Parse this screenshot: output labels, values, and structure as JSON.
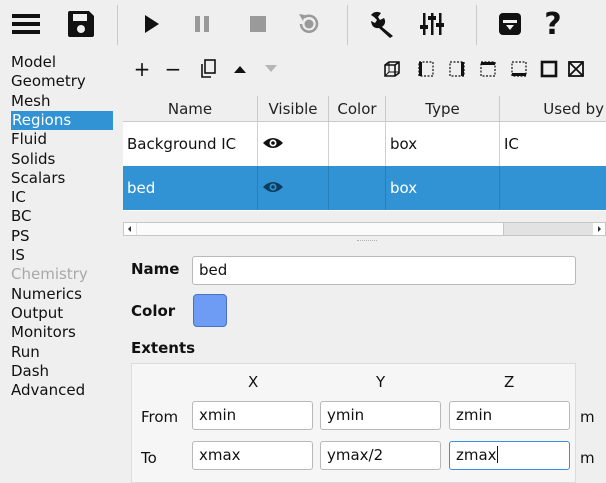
{
  "toolbar": {
    "icons": [
      "menu-icon",
      "save-icon",
      "play-icon",
      "pause-icon",
      "stop-icon",
      "reset-icon",
      "wrench-icon",
      "sliders-icon",
      "archive-icon",
      "help-icon"
    ],
    "help_label": "?"
  },
  "sidebar": {
    "items": [
      {
        "label": "Model",
        "state": "normal"
      },
      {
        "label": "Geometry",
        "state": "normal"
      },
      {
        "label": "Mesh",
        "state": "normal"
      },
      {
        "label": "Regions",
        "state": "selected"
      },
      {
        "label": "Fluid",
        "state": "normal"
      },
      {
        "label": "Solids",
        "state": "normal"
      },
      {
        "label": "Scalars",
        "state": "normal"
      },
      {
        "label": "IC",
        "state": "normal"
      },
      {
        "label": "BC",
        "state": "normal"
      },
      {
        "label": "PS",
        "state": "normal"
      },
      {
        "label": "IS",
        "state": "normal"
      },
      {
        "label": "Chemistry",
        "state": "disabled"
      },
      {
        "label": "Numerics",
        "state": "normal"
      },
      {
        "label": "Output",
        "state": "normal"
      },
      {
        "label": "Monitors",
        "state": "normal"
      },
      {
        "label": "Run",
        "state": "normal"
      },
      {
        "label": "Dash",
        "state": "normal"
      },
      {
        "label": "Advanced",
        "state": "normal"
      }
    ]
  },
  "subtoolbar": {
    "add": "+",
    "remove": "−"
  },
  "table": {
    "columns": [
      "Name",
      "Visible",
      "Color",
      "Type",
      "Used by"
    ],
    "rows": [
      {
        "name": "Background IC",
        "type": "box",
        "used_by": "IC",
        "selected": false
      },
      {
        "name": "bed",
        "type": "box",
        "used_by": "",
        "selected": true
      }
    ]
  },
  "form": {
    "name_label": "Name",
    "name_value": "bed",
    "color_label": "Color",
    "color_value": "#6e9cf5",
    "extents_label": "Extents",
    "axis_x": "X",
    "axis_y": "Y",
    "axis_z": "Z",
    "from_label": "From",
    "to_label": "To",
    "from": {
      "x": "xmin",
      "y": "ymin",
      "z": "zmin"
    },
    "to": {
      "x": "xmax",
      "y": "ymax/2",
      "z": "zmax"
    },
    "unit_from": "m",
    "unit_to": "m"
  },
  "colors": {
    "accent": "#3193d4",
    "focus_border": "#3a8ee6"
  }
}
